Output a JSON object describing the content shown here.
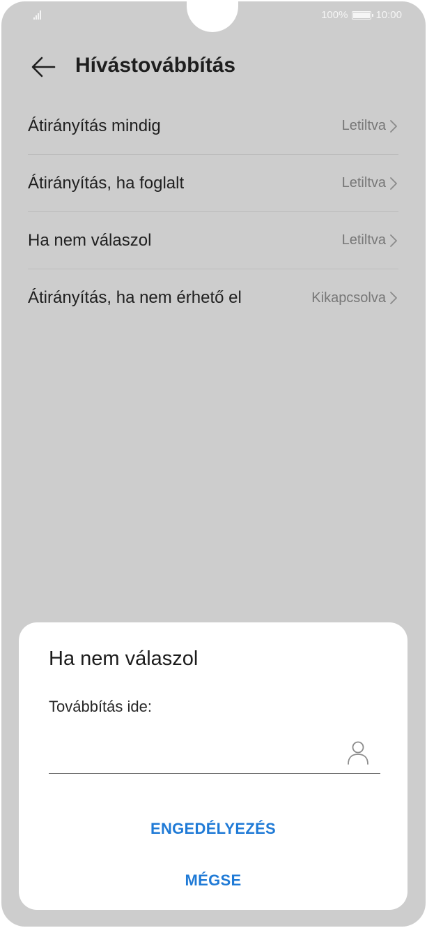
{
  "status_bar": {
    "battery_percent": "100%",
    "time": "10:00"
  },
  "header": {
    "title": "Hívástovábbítás",
    "back_icon": "arrow-left-icon"
  },
  "list": {
    "items": [
      {
        "label": "Átirányítás mindig",
        "value": "Letiltva"
      },
      {
        "label": "Átirányítás, ha foglalt",
        "value": "Letiltva"
      },
      {
        "label": "Ha nem válaszol",
        "value": "Letiltva"
      },
      {
        "label": "Átirányítás, ha nem érhető el",
        "value": "Kikapcsolva"
      }
    ]
  },
  "dialog": {
    "title": "Ha nem válaszol",
    "field_label": "Továbbítás ide:",
    "input_value": "",
    "contact_icon": "contact-person-icon",
    "allow_label": "ENGEDÉLYEZÉS",
    "cancel_label": "MÉGSE"
  },
  "colors": {
    "background_dim": "#cdcdcd",
    "accent": "#1f7ad6"
  }
}
